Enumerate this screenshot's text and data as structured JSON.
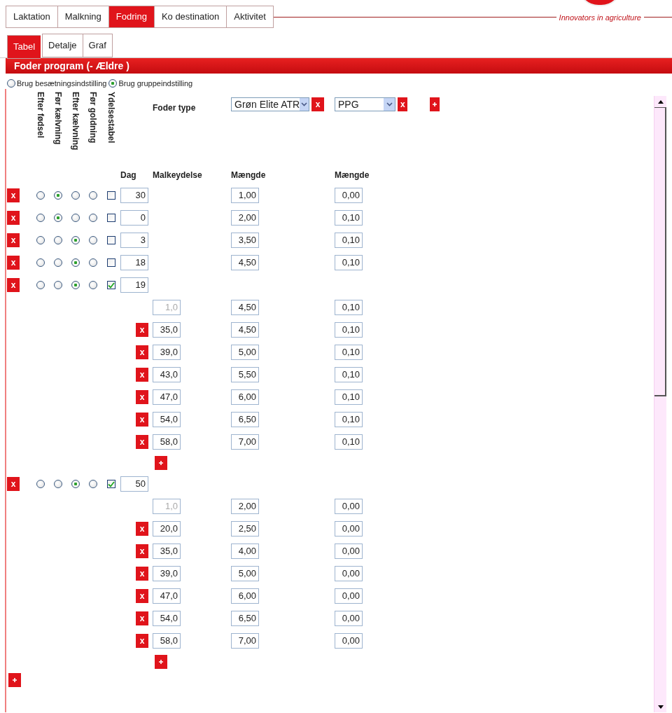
{
  "main_tabs": [
    {
      "label": "Laktation",
      "selected": false
    },
    {
      "label": "Malkning",
      "selected": false
    },
    {
      "label": "Fodring",
      "selected": true
    },
    {
      "label": "Ko destination",
      "selected": false
    },
    {
      "label": "Aktivitet",
      "selected": false
    }
  ],
  "logo": {
    "tagline": "Innovators in agriculture"
  },
  "sub_tabs": [
    {
      "label": "Tabel",
      "selected": true
    },
    {
      "label": "Detalje",
      "selected": false
    },
    {
      "label": "Graf",
      "selected": false
    }
  ],
  "panel": {
    "title": "Foder program (- Ældre )"
  },
  "settings": [
    {
      "label": "Brug besætningsindstilling",
      "selected": false
    },
    {
      "label": "Brug gruppeindstilling",
      "selected": true
    }
  ],
  "column_headers": [
    "Efter fødsel",
    "Før kælvning",
    "Efter kælvning",
    "Før goldning",
    "Ydelsestabel"
  ],
  "feed_type": {
    "label": "Foder type",
    "feeds": [
      {
        "name": "Grøn Elite ATR",
        "delete": "x"
      },
      {
        "name": "PPG",
        "delete": "x"
      }
    ]
  },
  "table_headers": [
    "Dag",
    "Malkeydelse",
    "Mængde",
    "Mængde"
  ],
  "periods": [
    {
      "phase": [
        {
          "selected": false
        },
        {
          "selected": true
        },
        {
          "selected": false
        },
        {
          "selected": false
        }
      ],
      "delete": "x",
      "yield_table": false,
      "day": "30",
      "amounts": [
        "1,00",
        "0,00"
      ]
    },
    {
      "phase": [
        {
          "selected": false
        },
        {
          "selected": true
        },
        {
          "selected": false
        },
        {
          "selected": false
        }
      ],
      "delete": "x",
      "yield_table": false,
      "day": "0",
      "amounts": [
        "2,00",
        "0,10"
      ]
    },
    {
      "phase": [
        {
          "selected": false
        },
        {
          "selected": false
        },
        {
          "selected": true
        },
        {
          "selected": false
        }
      ],
      "delete": "x",
      "yield_table": false,
      "day": "3",
      "amounts": [
        "3,50",
        "0,10"
      ]
    },
    {
      "phase": [
        {
          "selected": false
        },
        {
          "selected": false
        },
        {
          "selected": true
        },
        {
          "selected": false
        }
      ],
      "delete": "x",
      "yield_table": false,
      "day": "18",
      "amounts": [
        "4,50",
        "0,10"
      ]
    },
    {
      "phase": [
        {
          "selected": false
        },
        {
          "selected": false
        },
        {
          "selected": true
        },
        {
          "selected": false
        }
      ],
      "delete": "x",
      "yield_table": true,
      "day": "19",
      "steps": [
        {
          "yield": "1,0",
          "disabled": true,
          "amounts": [
            "4,50",
            "0,10"
          ]
        },
        {
          "delete": "x",
          "yield": "35,0",
          "disabled": false,
          "amounts": [
            "4,50",
            "0,10"
          ]
        },
        {
          "delete": "x",
          "yield": "39,0",
          "disabled": false,
          "amounts": [
            "5,00",
            "0,10"
          ]
        },
        {
          "delete": "x",
          "yield": "43,0",
          "disabled": false,
          "amounts": [
            "5,50",
            "0,10"
          ]
        },
        {
          "delete": "x",
          "yield": "47,0",
          "disabled": false,
          "amounts": [
            "6,00",
            "0,10"
          ]
        },
        {
          "delete": "x",
          "yield": "54,0",
          "disabled": false,
          "amounts": [
            "6,50",
            "0,10"
          ]
        },
        {
          "delete": "x",
          "yield": "58,0",
          "disabled": false,
          "amounts": [
            "7,00",
            "0,10"
          ]
        }
      ]
    },
    {
      "phase": [
        {
          "selected": false
        },
        {
          "selected": false
        },
        {
          "selected": true
        },
        {
          "selected": false
        }
      ],
      "delete": "x",
      "yield_table": true,
      "day": "50",
      "steps": [
        {
          "yield": "1,0",
          "disabled": true,
          "amounts": [
            "2,00",
            "0,00"
          ]
        },
        {
          "delete": "x",
          "yield": "20,0",
          "disabled": false,
          "amounts": [
            "2,50",
            "0,00"
          ]
        },
        {
          "delete": "x",
          "yield": "35,0",
          "disabled": false,
          "amounts": [
            "4,00",
            "0,00"
          ]
        },
        {
          "delete": "x",
          "yield": "39,0",
          "disabled": false,
          "amounts": [
            "5,00",
            "0,00"
          ]
        },
        {
          "delete": "x",
          "yield": "47,0",
          "disabled": false,
          "amounts": [
            "6,00",
            "0,00"
          ]
        },
        {
          "delete": "x",
          "yield": "54,0",
          "disabled": false,
          "amounts": [
            "6,50",
            "0,00"
          ]
        },
        {
          "delete": "x",
          "yield": "58,0",
          "disabled": false,
          "amounts": [
            "7,00",
            "0,00"
          ]
        }
      ]
    }
  ]
}
